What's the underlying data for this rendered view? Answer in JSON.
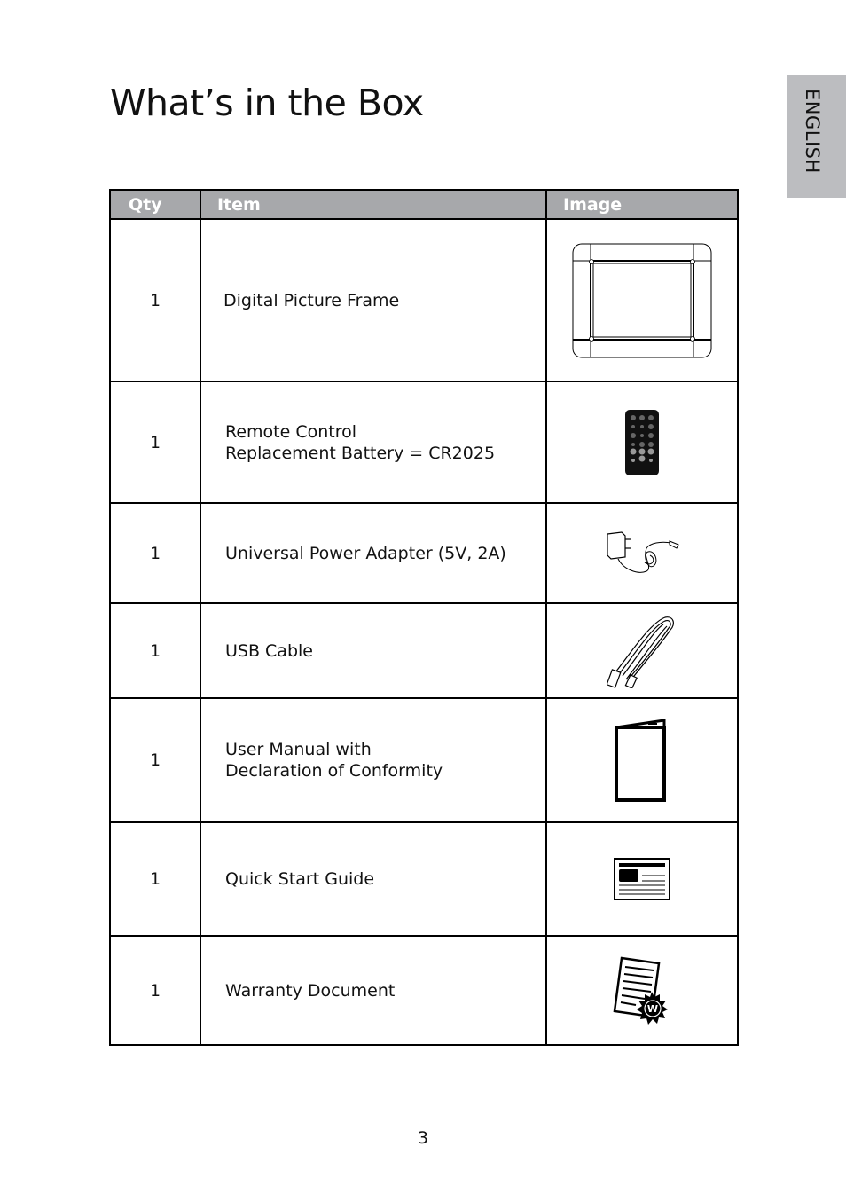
{
  "page": {
    "title": "What’s in the Box",
    "language_tab": "ENGLISH",
    "page_number": "3"
  },
  "table": {
    "headers": [
      "Qty",
      "Item",
      "Image"
    ],
    "rows": [
      {
        "qty": "1",
        "item_lines": [
          "Digital Picture Frame"
        ],
        "image": "digital-picture-frame-icon"
      },
      {
        "qty": "1",
        "item_lines": [
          "Remote Control",
          "Replacement Battery = CR2025"
        ],
        "image": "remote-control-icon"
      },
      {
        "qty": "1",
        "item_lines": [
          "Universal Power Adapter (5V, 2A)"
        ],
        "image": "power-adapter-icon"
      },
      {
        "qty": "1",
        "item_lines": [
          "USB Cable"
        ],
        "image": "usb-cable-icon"
      },
      {
        "qty": "1",
        "item_lines": [
          "User Manual with",
          "Declaration of Conformity"
        ],
        "image": "user-manual-icon"
      },
      {
        "qty": "1",
        "item_lines": [
          "Quick Start Guide"
        ],
        "image": "quick-start-guide-icon"
      },
      {
        "qty": "1",
        "item_lines": [
          "Warranty Document"
        ],
        "image": "warranty-document-icon"
      }
    ]
  }
}
